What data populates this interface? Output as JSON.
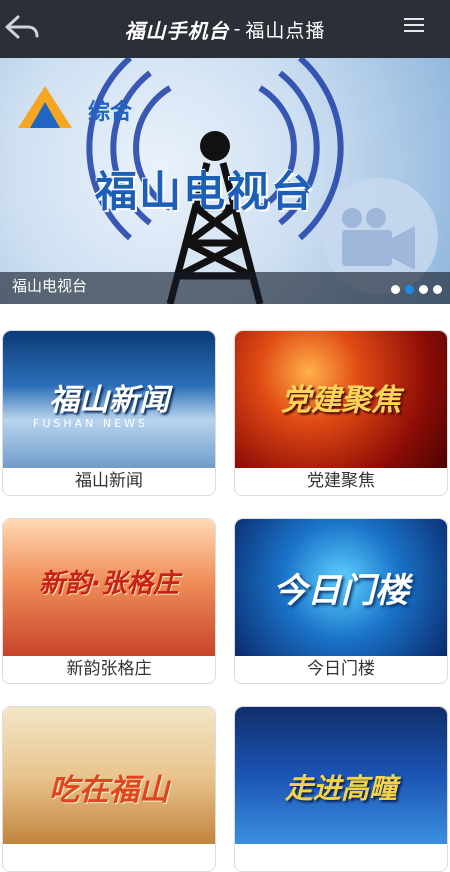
{
  "header": {
    "back_icon": "back-arrow-icon",
    "brand": "福山手机台",
    "separator": "-",
    "section": "福山点播",
    "menu_icon": "hamburger-menu-icon"
  },
  "banner": {
    "logo_text": "综合",
    "main_text": "福山电视台",
    "caption": "福山电视台",
    "slide_count": 4,
    "active_slide": 1,
    "accent_color": "#1e88e5"
  },
  "channels": [
    {
      "label": "福山新闻",
      "thumb_text": "福山新闻",
      "thumb_sub": "FUSHAN NEWS"
    },
    {
      "label": "党建聚焦",
      "thumb_text": "党建聚焦"
    },
    {
      "label": "新韵张格庄",
      "thumb_text": "新韵·张格庄"
    },
    {
      "label": "今日门楼",
      "thumb_text": "今日门楼"
    },
    {
      "label": "",
      "thumb_text": "吃在福山"
    },
    {
      "label": "",
      "thumb_text": "走进高疃"
    }
  ],
  "colors": {
    "header_bg": "#2b2f38",
    "card_border": "#dcdcdc",
    "label_text": "#333333"
  }
}
